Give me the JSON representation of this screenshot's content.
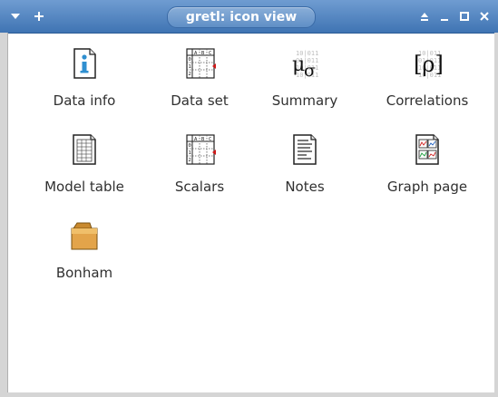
{
  "window": {
    "title": "gretl: icon view"
  },
  "icons": [
    {
      "label": "Data info",
      "icon": "data-info-icon"
    },
    {
      "label": "Data set",
      "icon": "spreadsheet-icon"
    },
    {
      "label": "Summary",
      "icon": "summary-stats-icon"
    },
    {
      "label": "Correlations",
      "icon": "correlation-icon"
    },
    {
      "label": "Model table",
      "icon": "model-table-icon"
    },
    {
      "label": "Scalars",
      "icon": "spreadsheet-icon"
    },
    {
      "label": "Notes",
      "icon": "notes-icon"
    },
    {
      "label": "Graph page",
      "icon": "graph-page-icon"
    },
    {
      "label": "Bonham",
      "icon": "folder-icon"
    }
  ],
  "colors": {
    "titlebar": "#4f82bf",
    "title_text": "#ffffff",
    "label_text": "#303030",
    "frame": "#d5d5d5"
  }
}
